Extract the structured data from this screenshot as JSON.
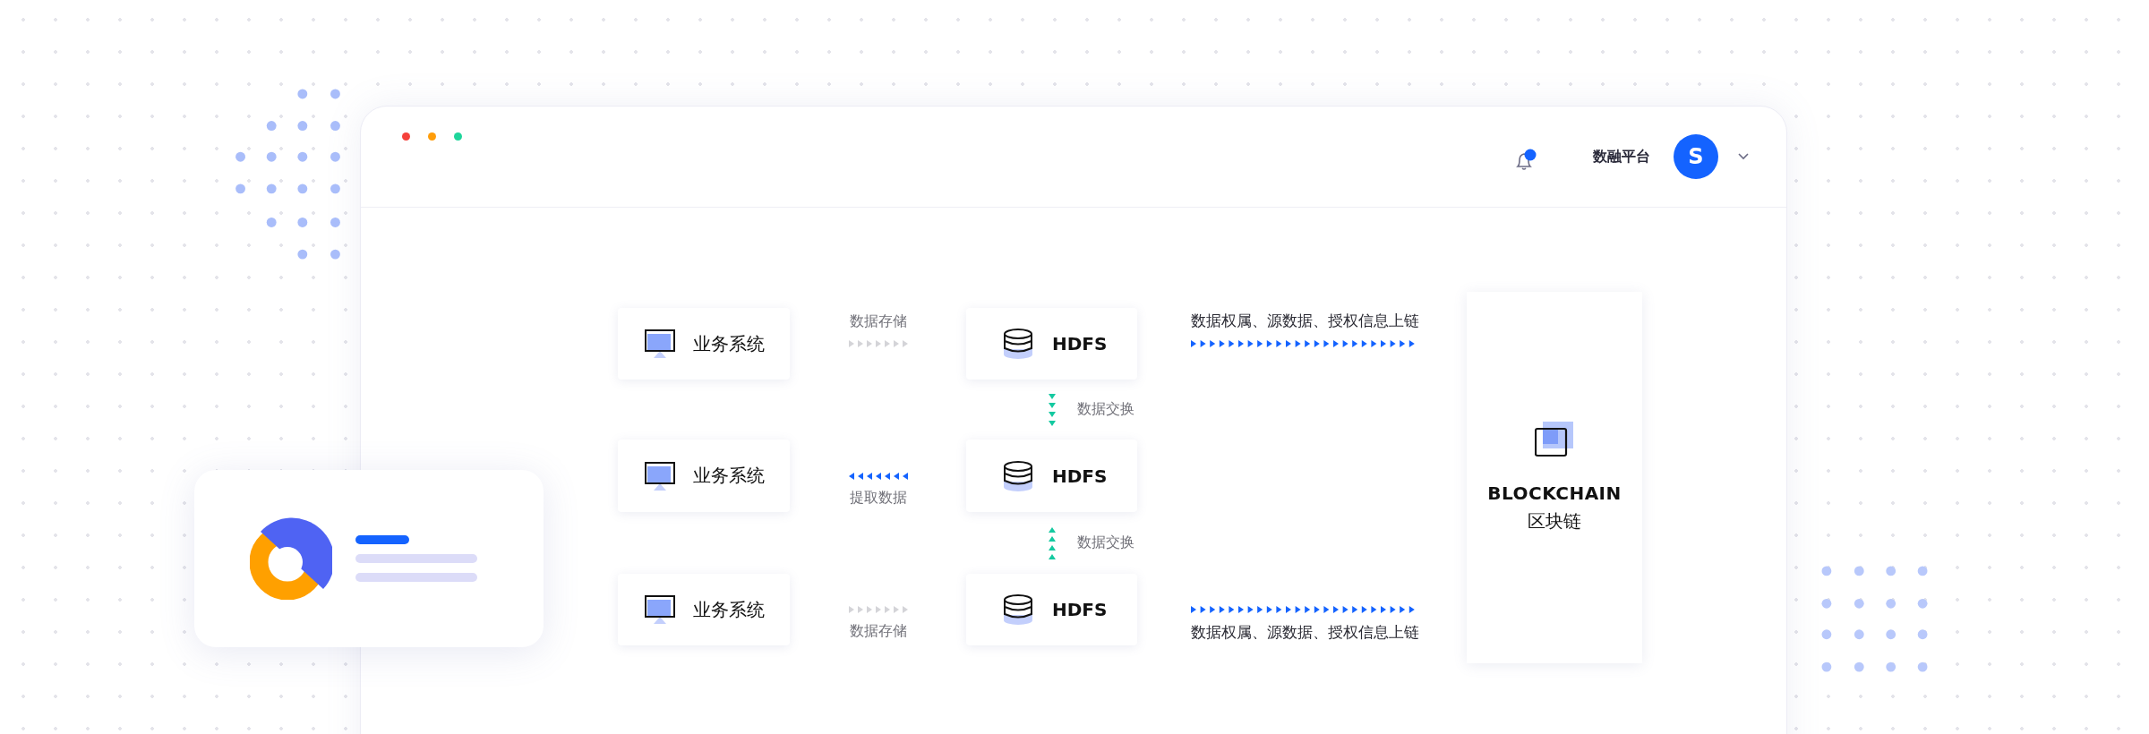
{
  "window": {
    "controls": [
      {
        "color": "#f5413b"
      },
      {
        "color": "#ff9d0a"
      },
      {
        "color": "#1ed59b"
      }
    ]
  },
  "header": {
    "notification": {
      "unread": true
    },
    "platform": "数融平台",
    "avatar": "S"
  },
  "diagram": {
    "rows": [
      {
        "system": "业务系统",
        "flow": {
          "label_top": "数据存储",
          "kind": "forward",
          "color": "#d4d4d8"
        },
        "hdfs": "HDFS",
        "chain": {
          "label_top": "数据权属、源数据、授权信息上链"
        }
      },
      {
        "system": "业务系统",
        "flow": {
          "label_bottom": "提取数据",
          "kind": "backward",
          "color": "#1463ff"
        },
        "hdfs": "HDFS"
      },
      {
        "system": "业务系统",
        "flow": {
          "label_bottom": "数据存储",
          "kind": "forward",
          "color": "#d4d4d8"
        },
        "hdfs": "HDFS",
        "chain": {
          "label_bottom": "数据权属、源数据、授权信息上链"
        }
      }
    ],
    "exchanges": [
      {
        "label": "数据交换",
        "kind": "down"
      },
      {
        "label": "数据交换",
        "kind": "up"
      }
    ],
    "blockchain": {
      "title": "BLOCKCHAIN",
      "subtitle": "区块链"
    }
  }
}
